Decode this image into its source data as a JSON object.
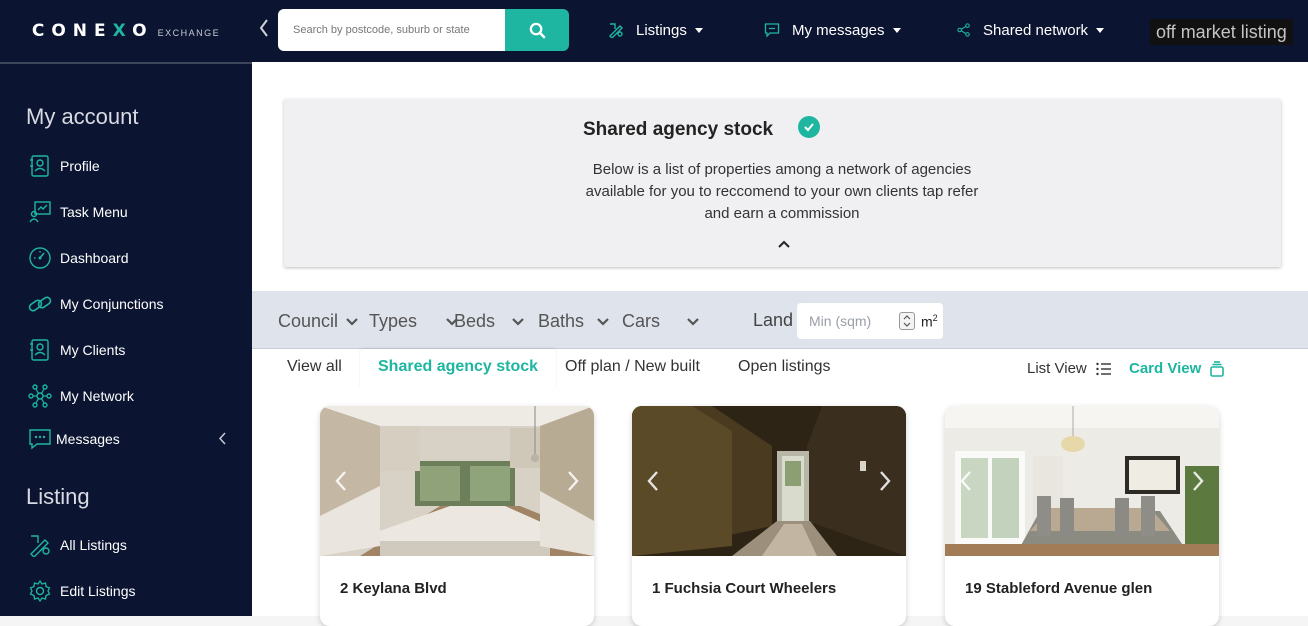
{
  "brand": {
    "name_a": "CONE",
    "name_x": "X",
    "name_b": "O",
    "sub": "EXCHANGE"
  },
  "search": {
    "placeholder": "Search by postcode, suburb or state"
  },
  "nav": {
    "listings": "Listings",
    "messages": "My messages",
    "shared": "Shared network",
    "off_market": "off market listing"
  },
  "sidebar": {
    "account_heading": "My account",
    "account_items": [
      {
        "label": "Profile",
        "icon": "profile-icon"
      },
      {
        "label": "Task Menu",
        "icon": "task-menu-icon"
      },
      {
        "label": "Dashboard",
        "icon": "dashboard-icon"
      },
      {
        "label": "My Conjunctions",
        "icon": "link-icon"
      },
      {
        "label": "My Clients",
        "icon": "clients-icon"
      },
      {
        "label": "My Network",
        "icon": "network-icon"
      },
      {
        "label": "Messages",
        "icon": "chat-icon"
      }
    ],
    "listing_heading": "Listing",
    "listing_items": [
      {
        "label": "All Listings",
        "icon": "listings-icon"
      },
      {
        "label": "Edit Listings",
        "icon": "gear-icon"
      }
    ]
  },
  "info": {
    "title": "Shared agency stock",
    "description": "Below is a list of properties among a network of agencies available for you to reccomend to your own clients tap refer and earn a commission"
  },
  "filters": {
    "council": "Council",
    "types": "Types",
    "beds": "Beds",
    "baths": "Baths",
    "cars": "Cars",
    "land_label": "Land",
    "land_placeholder": "Min (sqm)",
    "unit": "m",
    "unit_sup": "2"
  },
  "tabs": {
    "all": "View all",
    "shared": "Shared agency stock",
    "offplan": "Off plan / New built",
    "open": "Open listings"
  },
  "views": {
    "list": "List View",
    "card": "Card View"
  },
  "cards": [
    {
      "title": "2 Keylana Blvd"
    },
    {
      "title": "1 Fuchsia Court Wheelers"
    },
    {
      "title": "19 Stableford Avenue glen"
    }
  ],
  "colors": {
    "accent": "#1eb6a0",
    "navy": "#0b1430"
  }
}
